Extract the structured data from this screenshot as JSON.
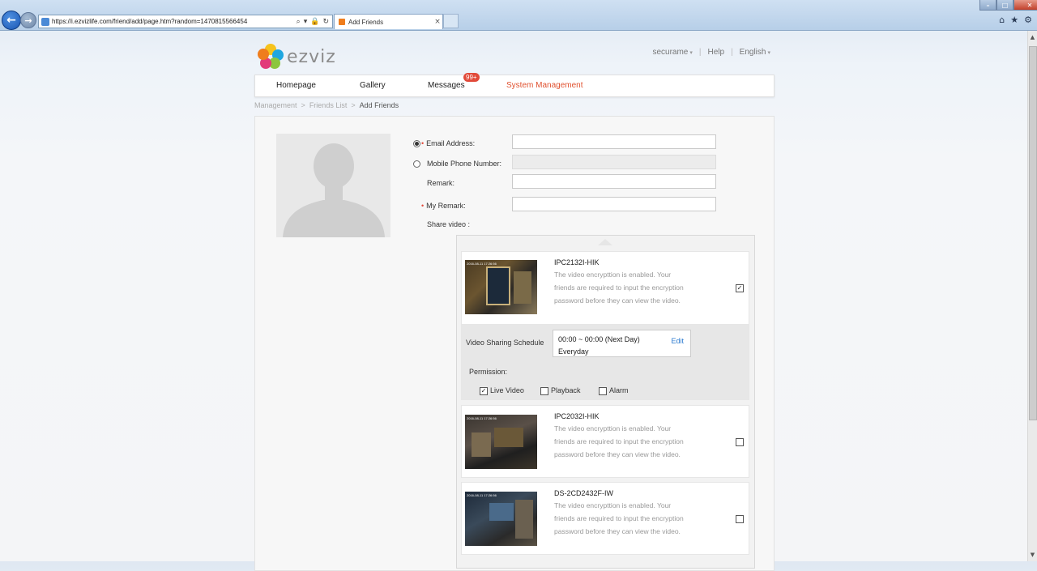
{
  "browser": {
    "url": "https://i.ezvizlife.com/friend/add/page.htm?random=1470815566454",
    "tab_title": "Add Friends",
    "tab_close": "×",
    "back_glyph": "←",
    "forward_glyph": "→",
    "address_tools": [
      "⌕",
      "▾",
      "🔒",
      "↻"
    ],
    "window_controls": {
      "minimize": "–",
      "maximize": "□",
      "close": "✕"
    },
    "command_icons": [
      "⌂",
      "★",
      "⚙"
    ]
  },
  "header": {
    "logo_text": "ezviz",
    "user": "securame",
    "help": "Help",
    "language": "English",
    "separator": "|",
    "caret": "▾"
  },
  "nav": {
    "items": [
      "Homepage",
      "Gallery",
      "Messages",
      "System Management"
    ],
    "active_index": 3,
    "messages_badge": "99+"
  },
  "breadcrumb": {
    "items": [
      "Management",
      ">",
      "Friends List",
      ">",
      "Add Friends"
    ]
  },
  "form": {
    "email_label": "Email Address:",
    "email_value": "",
    "phone_label": "Mobile Phone Number:",
    "phone_value": "",
    "remark_label": "Remark:",
    "remark_value": "",
    "my_remark_label": "My Remark:",
    "my_remark_value": "",
    "share_video_label": "Share video :",
    "required_mark": "•",
    "selected_contact_type": "email"
  },
  "cameras": [
    {
      "name": "IPC2132I-HIK",
      "description": "The video encrypttion is enabled. Your friends are required to input the encryption password before they can view the video.",
      "checked": true,
      "overlay_text": "2016-08-11 17:26:56"
    },
    {
      "name": "IPC2032I-HIK",
      "description": "The video encrypttion is enabled. Your friends are required to input the encryption password before they can view the video.",
      "checked": false,
      "overlay_text": "2016-08-11 17:26:56"
    },
    {
      "name": "DS-2CD2432F-IW",
      "description": "The video encrypttion is enabled. Your friends are required to input the encryption password before they can view the video.",
      "checked": false,
      "overlay_text": "2016-08-11 17:26:56"
    }
  ],
  "schedule": {
    "label": "Video Sharing Schedule",
    "time": "00:00 ~ 00:00 (Next Day)",
    "days": "Everyday",
    "edit": "Edit"
  },
  "permission": {
    "label": "Permission:",
    "options": [
      {
        "label": "Live Video",
        "checked": true
      },
      {
        "label": "Playback",
        "checked": false
      },
      {
        "label": "Alarm",
        "checked": false
      }
    ]
  },
  "glyphs": {
    "check": "✓",
    "up": "▲",
    "down": "▼"
  },
  "colors": {
    "accent": "#e0512f",
    "link": "#2a7ad0",
    "badge": "#e14a3a"
  }
}
